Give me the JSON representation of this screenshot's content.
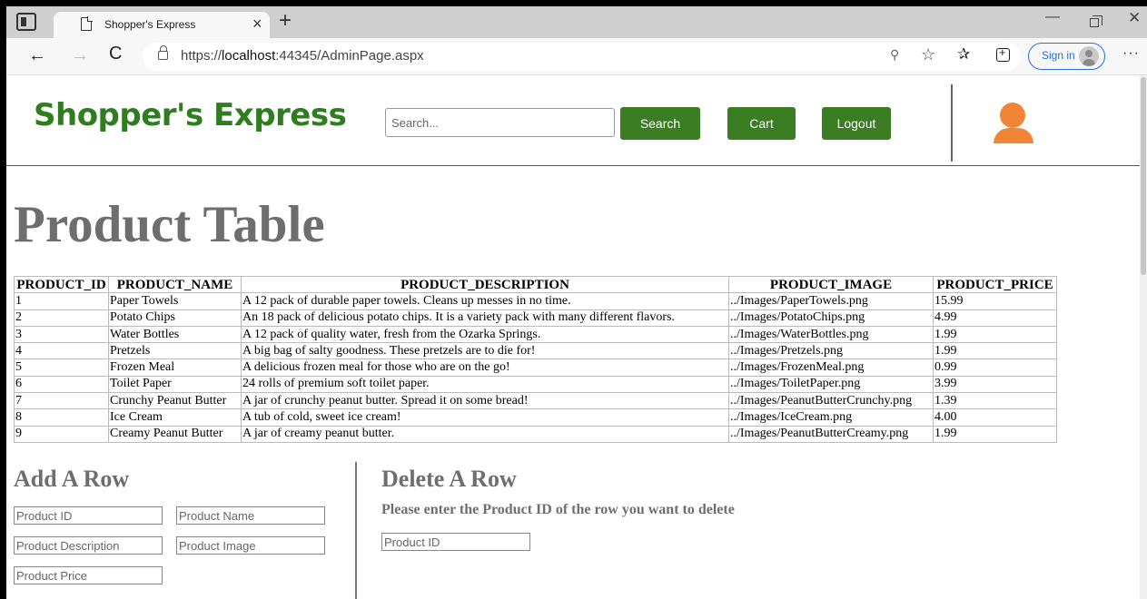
{
  "browser": {
    "tab_title": "Shopper's Express",
    "tab_close": "×",
    "new_tab": "+",
    "url_prefix": "https://",
    "url_host": "localhost",
    "url_rest": ":44345/AdminPage.aspx",
    "sign_in_label": "Sign in",
    "icons": {
      "back": "←",
      "forward": "→",
      "reload": "C",
      "minimize": "—",
      "close": "✕",
      "more": "···",
      "favorites": "✰",
      "fav_add": "☆",
      "key": "⚲"
    }
  },
  "header": {
    "logo": "Shopper's Express",
    "search_placeholder": "Search...",
    "search_button": "Search",
    "cart_button": "Cart",
    "logout_button": "Logout"
  },
  "page_title": "Product Table",
  "table": {
    "columns": [
      "PRODUCT_ID",
      "PRODUCT_NAME",
      "PRODUCT_DESCRIPTION",
      "PRODUCT_IMAGE",
      "PRODUCT_PRICE"
    ],
    "rows": [
      [
        "1",
        "Paper Towels",
        "A 12 pack of durable paper towels. Cleans up messes in no time.",
        "../Images/PaperTowels.png",
        "15.99"
      ],
      [
        "2",
        "Potato Chips",
        "An 18 pack of delicious potato chips. It is a variety pack with many different flavors.",
        "../Images/PotatoChips.png",
        "4.99"
      ],
      [
        "3",
        "Water Bottles",
        "A 12 pack of quality water, fresh from the Ozarka Springs.",
        "../Images/WaterBottles.png",
        "1.99"
      ],
      [
        "4",
        "Pretzels",
        "A big bag of salty goodness. These pretzels are to die for!",
        "../Images/Pretzels.png",
        "1.99"
      ],
      [
        "5",
        "Frozen Meal",
        "A delicious frozen meal for those who are on the go!",
        "../Images/FrozenMeal.png",
        "0.99"
      ],
      [
        "6",
        "Toilet Paper",
        "24 rolls of premium soft toilet paper.",
        "../Images/ToiletPaper.png",
        "3.99"
      ],
      [
        "7",
        "Crunchy Peanut Butter",
        "A jar of crunchy peanut butter. Spread it on some bread!",
        "../Images/PeanutButterCrunchy.png",
        "1.39"
      ],
      [
        "8",
        "Ice Cream",
        "A tub of cold, sweet ice cream!",
        "../Images/IceCream.png",
        "4.00"
      ],
      [
        "9",
        "Creamy Peanut Butter",
        "A jar of creamy peanut butter.",
        "../Images/PeanutButterCreamy.png",
        "1.99"
      ]
    ]
  },
  "add_row": {
    "title": "Add A Row",
    "id_placeholder": "Product ID",
    "name_placeholder": "Product Name",
    "description_placeholder": "Product Description",
    "image_placeholder": "Product Image",
    "price_placeholder": "Product Price"
  },
  "delete_row": {
    "title": "Delete A Row",
    "instruction": "Please enter the Product ID of the row you want to delete",
    "id_placeholder": "Product ID"
  },
  "colors": {
    "brand_green": "#2e7d1f",
    "button_green": "#3a7d22",
    "profile_orange": "#f08535",
    "heading_gray": "#6e6e6e",
    "link_blue": "#2a6ed8"
  }
}
